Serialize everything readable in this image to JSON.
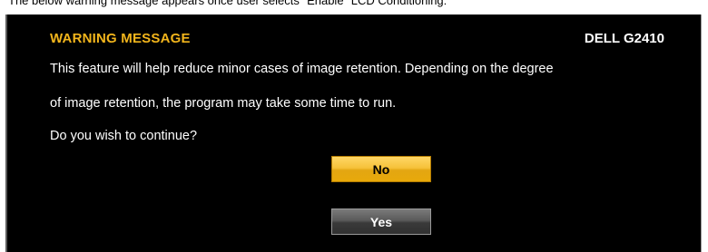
{
  "caption": "The below warning message appears once user selects \"Enable\" LCD Conditioning:",
  "osd": {
    "title": "WARNING MESSAGE",
    "model": "DELL G2410",
    "lines": [
      "This feature will help reduce minor cases of image retention. Depending on the degree",
      "of image retention, the program may take some time to run.",
      "Do you wish to continue?"
    ],
    "buttons": {
      "no_label": "No",
      "yes_label": "Yes"
    },
    "colors": {
      "background": "#000000",
      "title": "#f2b51c",
      "text": "#ffffff",
      "selected_button": "#f2b51c",
      "unselected_button": "#505050"
    },
    "selected_button": "No"
  }
}
